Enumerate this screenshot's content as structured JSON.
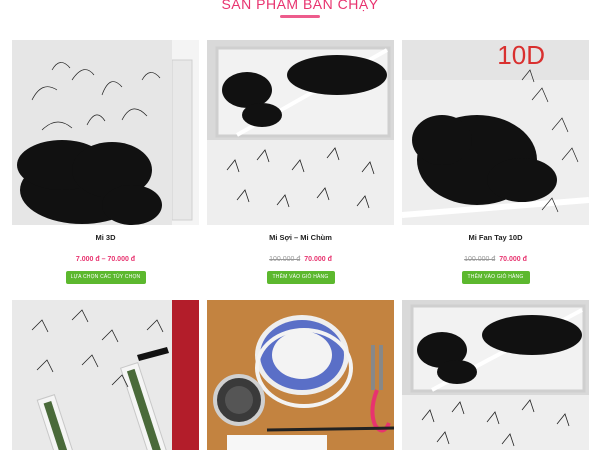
{
  "section": {
    "title": "SẢN PHẨM BÁN CHẠY"
  },
  "products": [
    {
      "name": "Mi 3D",
      "old_price": "",
      "price": "7.000 đ – 70.000 đ",
      "button": "Lựa chọn các tùy chọn",
      "badge": ""
    },
    {
      "name": "Mi Sợi – Mi Chùm",
      "old_price": "100.000 đ",
      "price": "70.000 đ",
      "button": "Thêm vào giỏ hàng",
      "badge": ""
    },
    {
      "name": "Mi Fan Tay 10D",
      "old_price": "100.000 đ",
      "price": "70.000 đ",
      "button": "Thêm vào giỏ hàng",
      "badge": "10D"
    },
    {
      "name": "",
      "old_price": "",
      "price": "",
      "button": "",
      "badge": ""
    },
    {
      "name": "",
      "old_price": "",
      "price": "",
      "button": "",
      "badge": ""
    },
    {
      "name": "",
      "old_price": "",
      "price": "",
      "button": "",
      "badge": ""
    }
  ],
  "colors": {
    "accent": "#e8336f",
    "button": "#5cb82e",
    "old_price": "#999999"
  }
}
